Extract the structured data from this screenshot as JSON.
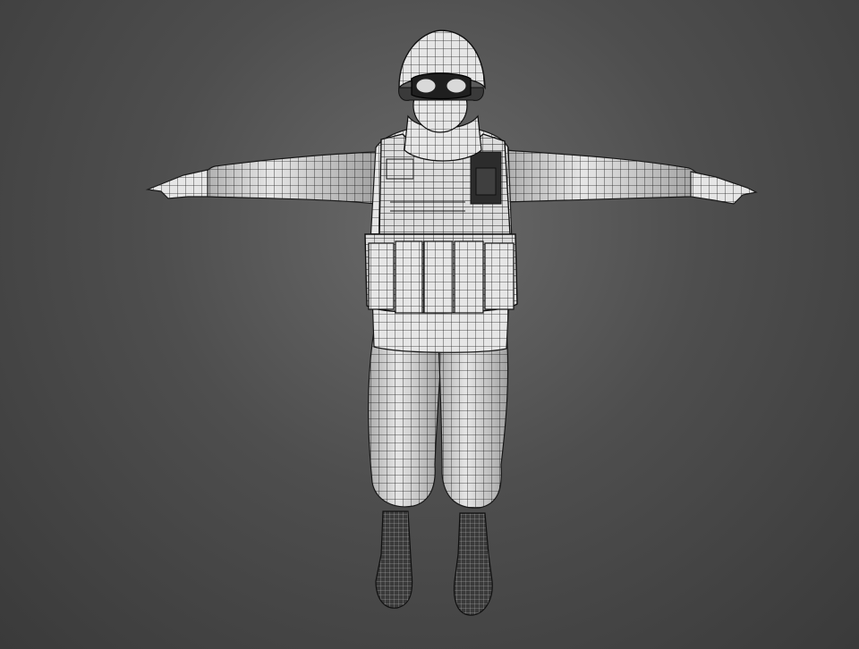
{
  "scene": {
    "background_color": "#4c4c4c",
    "mesh_fill_color": "#e8e8e8",
    "mesh_wire_color": "#1e1e1e",
    "boot_color": "#2a2a2a",
    "pose": "T-pose",
    "render_style": "wireframe-over-shaded"
  }
}
